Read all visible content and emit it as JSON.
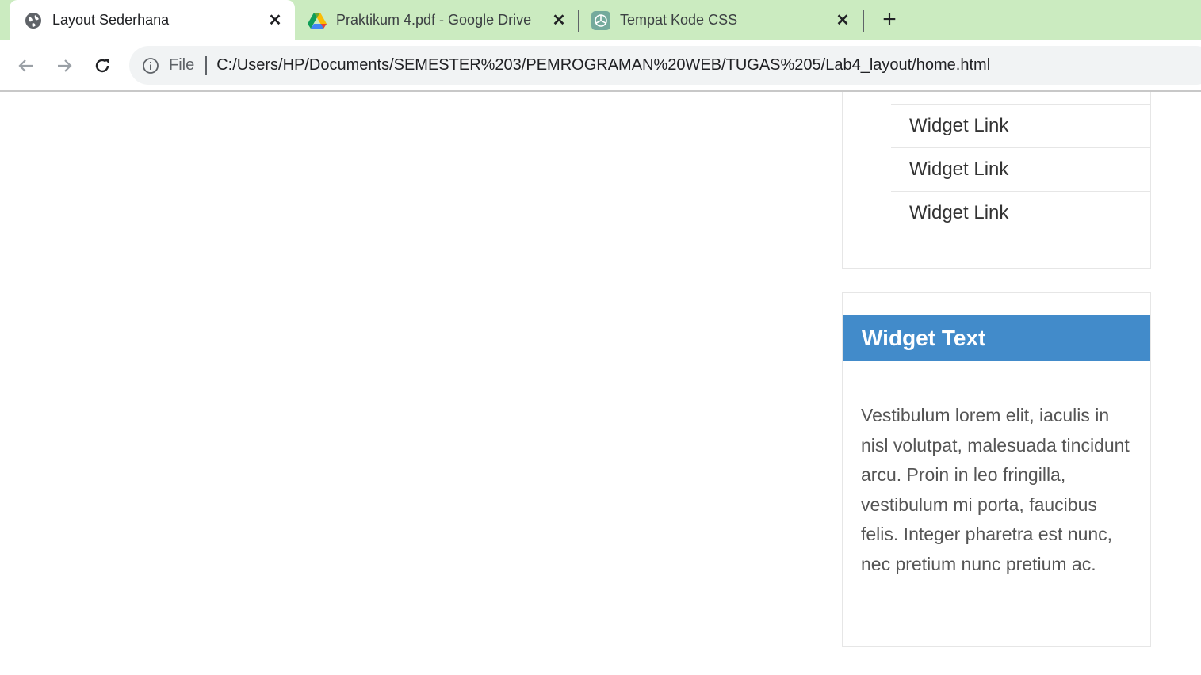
{
  "browser": {
    "tabs": [
      {
        "title": "Layout Sederhana",
        "favicon": "globe-icon",
        "active": true
      },
      {
        "title": "Praktikum 4.pdf - Google Drive",
        "favicon": "google-drive-icon",
        "active": false
      },
      {
        "title": "Tempat Kode CSS",
        "favicon": "chatgpt-icon",
        "active": false
      }
    ],
    "tab_close": "✕",
    "new_tab": "+",
    "address": {
      "scheme": "File",
      "url": "C:/Users/HP/Documents/SEMESTER%203/PEMROGRAMAN%20WEB/TUGAS%205/Lab4_layout/home.html"
    },
    "colors": {
      "tabstrip": "#cbebc0",
      "omnibox": "#f1f3f4"
    }
  },
  "page": {
    "widget_links": [
      "Widget Link",
      "Widget Link",
      "Widget Link",
      "Widget Link"
    ],
    "widget_text": {
      "title": "Widget Text",
      "body": "Vestibulum lorem elit, iaculis in nisl volutpat, malesuada tincidunt arcu. Proin in leo fringilla, vestibulum mi porta, faucibus felis. Integer pharetra est nunc, nec pretium nunc pretium ac."
    },
    "colors": {
      "widget_header": "#428bca"
    }
  }
}
